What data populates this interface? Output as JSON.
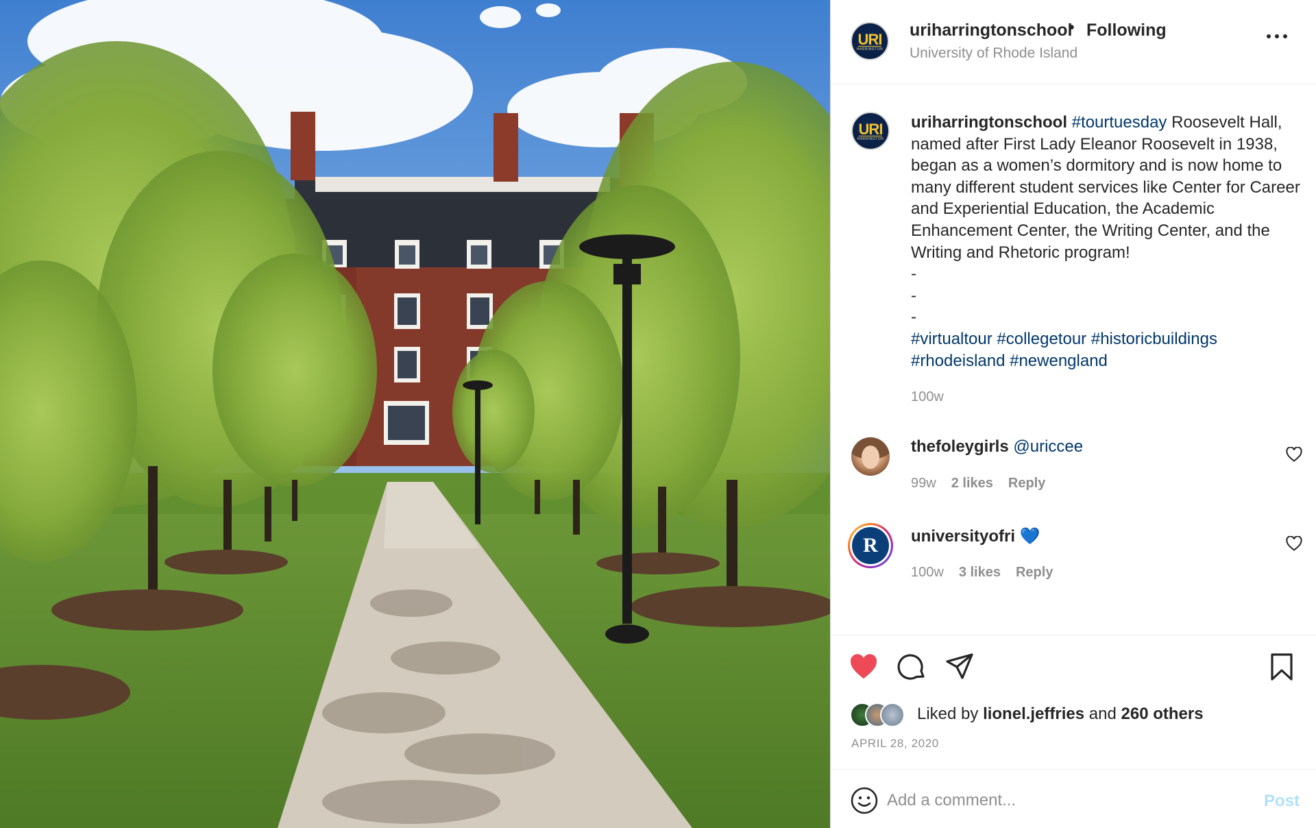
{
  "header": {
    "username": "uriharringtonschool",
    "separator": "•",
    "follow_status": "Following",
    "location": "University of Rhode Island",
    "avatar_logo": "URI",
    "avatar_sub": "HARRINGTON"
  },
  "caption": {
    "username": "uriharringtonschool",
    "lead_tag": "#tourtuesday",
    "body": "Roosevelt Hall, named after First Lady Eleanor Roosevelt in 1938, began as a women’s dormitory and is now home to many different student services like Center for Career and Experiential Education, the Academic Enhancement Center, the Writing Center, and the Writing and Rhetoric program!",
    "dashes": [
      "-",
      "-",
      "-"
    ],
    "tags": [
      "#virtualtour",
      "#collegetour",
      "#historicbuildings",
      "#rhodeisland",
      "#newengland"
    ],
    "time": "100w"
  },
  "comments": [
    {
      "username": "thefoleygirls",
      "text": "@uriccee",
      "time": "99w",
      "likes": "2 likes",
      "reply": "Reply"
    },
    {
      "username": "universityofri",
      "text": "💙",
      "time": "100w",
      "likes": "3 likes",
      "reply": "Reply",
      "avatar_letter": "R"
    }
  ],
  "actions": {
    "icons": [
      "heart-filled-icon",
      "comment-icon",
      "share-icon",
      "bookmark-icon"
    ],
    "liked_by_prefix": "Liked by",
    "liked_by_user": "lionel.jeffries",
    "liked_by_and": "and",
    "liked_by_others": "260 others",
    "date": "APRIL 28, 2020"
  },
  "comment_bar": {
    "placeholder": "Add a comment...",
    "post_label": "Post"
  },
  "colors": {
    "like_red": "#ed4956",
    "link_blue": "#00376b",
    "post_disabled": "#b2dffc",
    "muted": "#8e8e8e"
  }
}
